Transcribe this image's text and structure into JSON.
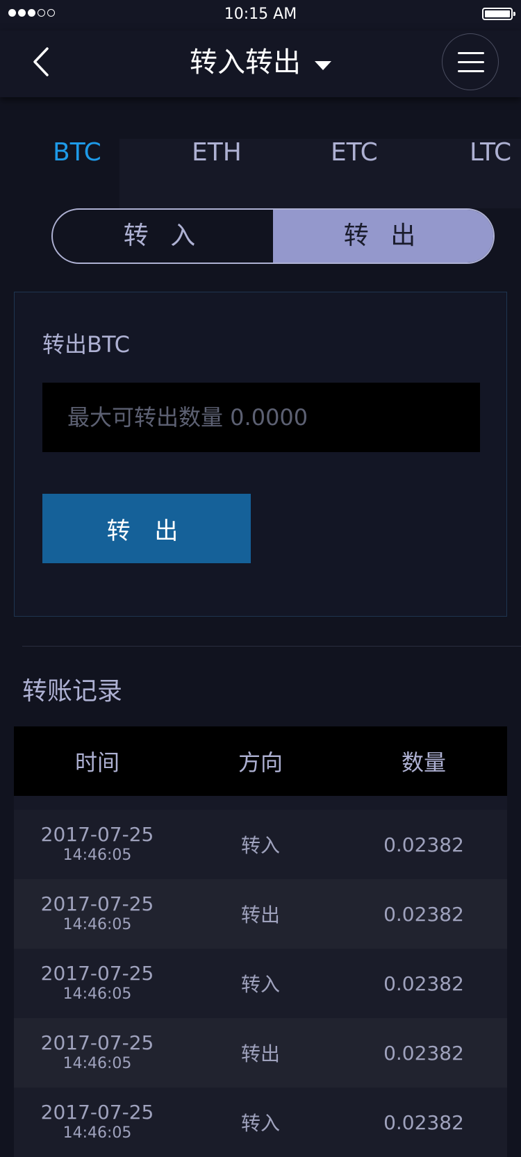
{
  "status_bar": {
    "time": "10:15 AM",
    "signal_bars": 3,
    "signal_total": 5,
    "battery_level": 1.0
  },
  "nav": {
    "title": "转入转出",
    "back_icon": "chevron-left-icon",
    "dropdown_icon": "caret-down-icon",
    "menu_icon": "hamburger-menu-icon"
  },
  "coin_tabs": [
    "BTC",
    "ETH",
    "ETC",
    "LTC"
  ],
  "active_coin": "BTC",
  "segment": {
    "in_label": "转 入",
    "out_label": "转 出",
    "selected": "out"
  },
  "transfer_form": {
    "title": "转出BTC",
    "input_placeholder": "最大可转出数量 0.0000",
    "input_value": "",
    "submit_label": "转 出"
  },
  "records": {
    "title": "转账记录",
    "columns": [
      "时间",
      "方向",
      "数量"
    ],
    "rows": [
      {
        "date": "2017-07-25",
        "time": "14:46:05",
        "direction": "转入",
        "amount": "0.02382"
      },
      {
        "date": "2017-07-25",
        "time": "14:46:05",
        "direction": "转出",
        "amount": "0.02382"
      },
      {
        "date": "2017-07-25",
        "time": "14:46:05",
        "direction": "转入",
        "amount": "0.02382"
      },
      {
        "date": "2017-07-25",
        "time": "14:46:05",
        "direction": "转出",
        "amount": "0.02382"
      },
      {
        "date": "2017-07-25",
        "time": "14:46:05",
        "direction": "转入",
        "amount": "0.02382"
      }
    ]
  },
  "colors": {
    "background": "#11131f",
    "accent": "#1e9ae8",
    "button": "#156199",
    "segment_selected": "#9498cc",
    "text": "#aeb1d3"
  }
}
